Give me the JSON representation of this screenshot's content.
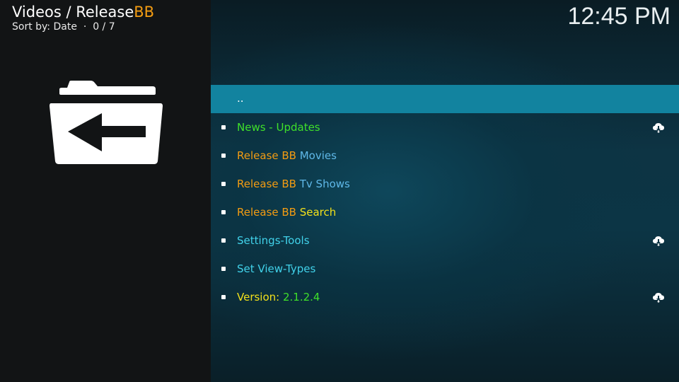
{
  "header": {
    "path_prefix": "Videos / Release",
    "path_highlight": "BB",
    "sort_label": "Sort by: Date",
    "separator": "·",
    "count": "0 / 7"
  },
  "clock": "12:45 PM",
  "colors": {
    "highlight": "#f39c12",
    "selected_row": "#12839f",
    "green": "#3fe02a",
    "yellow": "#f2e01a",
    "cyan": "#41d2ea",
    "blue": "#5fb8e8"
  },
  "items": [
    {
      "parts": [
        {
          "text": "..",
          "color": "white"
        }
      ],
      "selected": true,
      "cloud": false
    },
    {
      "parts": [
        {
          "text": "News - Updates",
          "color": "green"
        }
      ],
      "selected": false,
      "cloud": true
    },
    {
      "parts": [
        {
          "text": "Release BB ",
          "color": "orange"
        },
        {
          "text": "Movies",
          "color": "blue"
        }
      ],
      "selected": false,
      "cloud": false
    },
    {
      "parts": [
        {
          "text": "Release BB ",
          "color": "orange"
        },
        {
          "text": "Tv Shows",
          "color": "blue"
        }
      ],
      "selected": false,
      "cloud": false
    },
    {
      "parts": [
        {
          "text": "Release BB ",
          "color": "orange"
        },
        {
          "text": "Search",
          "color": "yellow"
        }
      ],
      "selected": false,
      "cloud": false
    },
    {
      "parts": [
        {
          "text": "Settings-Tools",
          "color": "cyan"
        }
      ],
      "selected": false,
      "cloud": true
    },
    {
      "parts": [
        {
          "text": "Set View-Types",
          "color": "cyan"
        }
      ],
      "selected": false,
      "cloud": false
    },
    {
      "parts": [
        {
          "text": "Version: ",
          "color": "yellow"
        },
        {
          "text": "2.1.2.4",
          "color": "green"
        }
      ],
      "selected": false,
      "cloud": true
    }
  ],
  "icons": {
    "folder": "folder-back-icon",
    "cloud": "cloud-download-icon",
    "bullet": "bullet-icon"
  }
}
